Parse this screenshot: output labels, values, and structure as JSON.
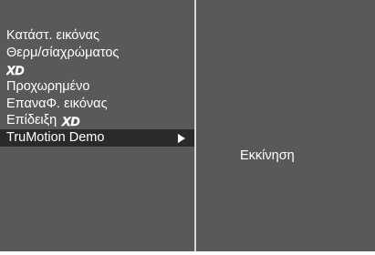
{
  "menu": {
    "items": [
      {
        "label": "Κατάστ. εικόνας"
      },
      {
        "label": "Θερμ/σίαχρώματος"
      },
      {
        "label": "XD",
        "logo": true
      },
      {
        "label": "Προχωρημένο"
      },
      {
        "label": "ΕπαναΦ. εικόνας"
      },
      {
        "label": "Επίδειξη",
        "logo_label": "XD"
      },
      {
        "label": "TruMotion Demo",
        "selected": true,
        "has_submenu": true
      }
    ]
  },
  "submenu": {
    "start_label": "Εκκίνηση"
  },
  "colors": {
    "panel": "#595959",
    "selected": "#2a2a2a",
    "text": "#ffffff"
  }
}
